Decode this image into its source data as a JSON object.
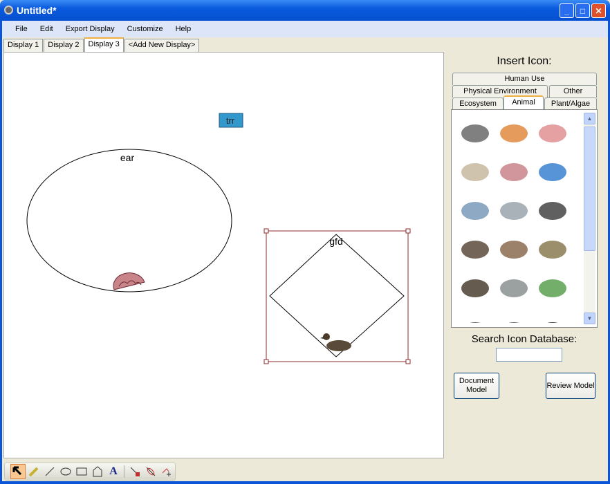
{
  "window": {
    "title": "Untitled*"
  },
  "menu": [
    "File",
    "Edit",
    "Export Display",
    "Customize",
    "Help"
  ],
  "display_tabs": [
    {
      "label": "Display 1"
    },
    {
      "label": "Display 2"
    },
    {
      "label": "Display 3",
      "active": true
    },
    {
      "label": "<Add New Display>"
    }
  ],
  "canvas": {
    "nodes": [
      {
        "label": "trr",
        "shape": "label-box",
        "color": "#3399cc"
      },
      {
        "label": "ear",
        "shape": "ellipse",
        "icon": "brain-coral"
      },
      {
        "label": "gfd",
        "shape": "diamond",
        "icon": "duck",
        "selected": true
      }
    ]
  },
  "panel": {
    "title": "Insert Icon:",
    "tabs": {
      "row1": [
        "Human Use"
      ],
      "row2": [
        "Physical Environment",
        "Other"
      ],
      "row3": [
        "Ecosystem",
        "Animal",
        "Plant/Algae"
      ]
    },
    "active_tab": "Animal",
    "icons": [
      "turtle",
      "crab",
      "sea-star",
      "oyster",
      "brain-coral",
      "angelfish",
      "dolphin",
      "shark",
      "manta-ray",
      "duck",
      "bird",
      "grasshopper",
      "rattlesnake",
      "lizard",
      "frog",
      "animal",
      "animal",
      "cow"
    ],
    "search_label": "Search Icon Database:",
    "search_value": "",
    "document_model": "Document Model",
    "review_model": "Review Model"
  },
  "tools": [
    "select",
    "pencil",
    "line",
    "ellipse",
    "rectangle",
    "polygon",
    "text",
    "connect",
    "disconnect",
    "add-link"
  ]
}
